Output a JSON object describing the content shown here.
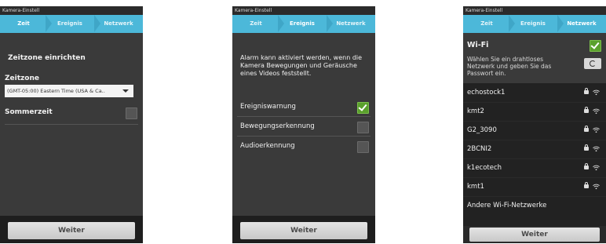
{
  "titlebar": "Kamera-Einstell",
  "tabs": [
    "Zeit",
    "Ereignis",
    "Netzwerk"
  ],
  "colors": {
    "tab_bg": "#4cb8d9",
    "check_on": "#5aa02c"
  },
  "screen1": {
    "heading": "Zeitzone einrichten",
    "zone_label": "Zeitzone",
    "zone_value": "(GMT-05:00) Eastern Time (USA & Ca..",
    "dst_label": "Sommerzeit",
    "dst_checked": false,
    "button": "Weiter"
  },
  "screen2": {
    "description": "Alarm kann aktiviert werden, wenn die Kamera Bewegungen und Geräusche eines Videos feststellt.",
    "options": [
      {
        "label": "Ereigniswarnung",
        "checked": true
      },
      {
        "label": "Bewegungserkennung",
        "checked": false
      },
      {
        "label": "Audioerkennung",
        "checked": false
      }
    ],
    "button": "Weiter"
  },
  "screen3": {
    "wifi_label": "Wi-Fi",
    "wifi_checked": true,
    "instruction": "Wählen Sie ein drahtloses Netzwerk und geben Sie das Passwort ein.",
    "networks": [
      "echostock1",
      "kmt2",
      "G2_3090",
      "2BCNI2",
      "k1ecotech",
      "kmt1"
    ],
    "other": "Andere Wi-Fi-Netzwerke",
    "button": "Weiter"
  }
}
